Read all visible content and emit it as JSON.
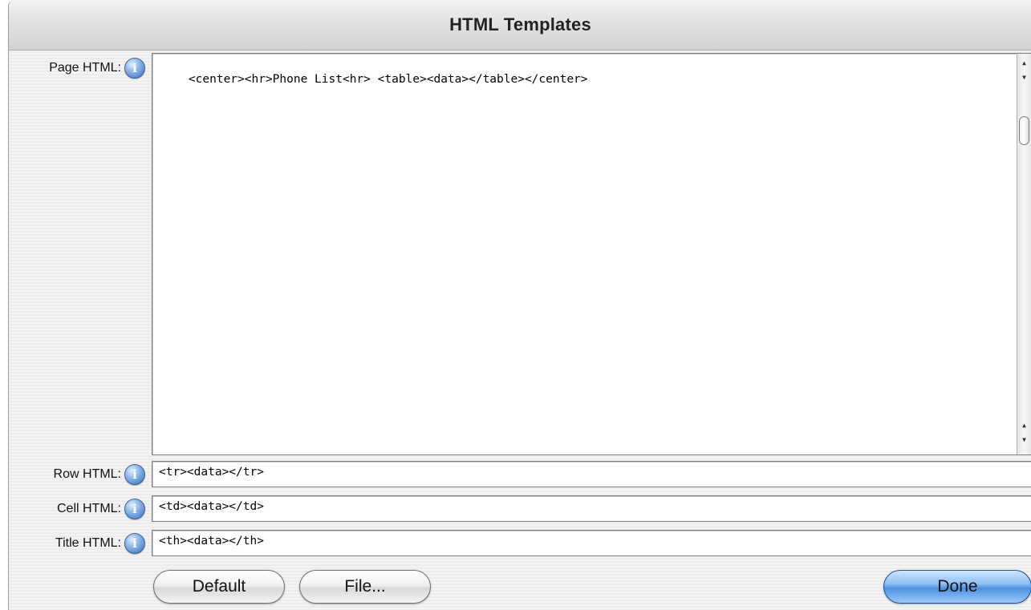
{
  "window": {
    "title": "HTML Templates"
  },
  "fields": {
    "page": {
      "label": "Page HTML:",
      "value": "<center><hr>Phone List<hr> <table><data></table></center>"
    },
    "row": {
      "label": "Row HTML:",
      "value": "<tr><data></tr>"
    },
    "cell": {
      "label": "Cell HTML:",
      "value": "<td><data></td>"
    },
    "title": {
      "label": "Title HTML:",
      "value": "<th><data></th>"
    }
  },
  "icons": {
    "info": "i"
  },
  "buttons": {
    "default": "Default",
    "file": "File...",
    "done": "Done"
  },
  "colors": {
    "accent": "#4b91e2"
  }
}
